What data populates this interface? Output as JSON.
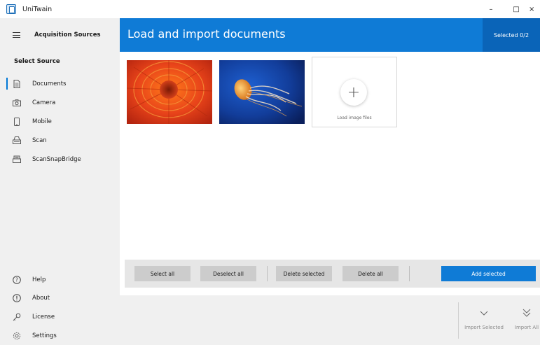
{
  "window": {
    "title": "UniTwain",
    "minimize": "–",
    "maximize": "□",
    "close": "×"
  },
  "sidebar": {
    "title": "Acquisition Sources",
    "section": "Select Source",
    "sources": [
      {
        "label": "Documents",
        "icon": "document-icon"
      },
      {
        "label": "Camera",
        "icon": "camera-icon"
      },
      {
        "label": "Mobile",
        "icon": "mobile-icon"
      },
      {
        "label": "Scan",
        "icon": "scanner-icon"
      },
      {
        "label": "ScanSnapBridge",
        "icon": "scansnap-icon"
      }
    ],
    "footer": [
      {
        "label": "Help",
        "icon": "help-icon"
      },
      {
        "label": "About",
        "icon": "info-icon"
      },
      {
        "label": "License",
        "icon": "key-icon"
      },
      {
        "label": "Settings",
        "icon": "gear-icon"
      }
    ]
  },
  "header": {
    "title": "Load and import documents",
    "selected": "Selected 0/2"
  },
  "content": {
    "load_label": "Load image files"
  },
  "actions": {
    "select_all": "Select all",
    "deselect_all": "Deselect all",
    "delete_selected": "Delete selected",
    "delete_all": "Delete all",
    "add_selected": "Add selected"
  },
  "import": {
    "selected": "Import Selected",
    "all": "Import All"
  },
  "colors": {
    "accent": "#0f7bd6",
    "accent_dark": "#0a64b8"
  }
}
